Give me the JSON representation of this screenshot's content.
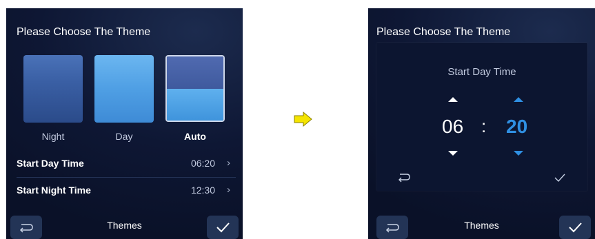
{
  "left_screen": {
    "title": "Please Choose The Theme",
    "themes": [
      {
        "label": "Night",
        "selected": false
      },
      {
        "label": "Day",
        "selected": false
      },
      {
        "label": "Auto",
        "selected": true
      }
    ],
    "rows": [
      {
        "label": "Start Day Time",
        "value": "06:20"
      },
      {
        "label": "Start Night Time",
        "value": "12:30"
      }
    ],
    "bottom_bar": {
      "title": "Themes"
    }
  },
  "right_screen": {
    "title": "Please Choose The Theme",
    "dialog": {
      "title": "Start Day Time",
      "hour": "06",
      "separator": ":",
      "minute": "20"
    },
    "bottom_bar": {
      "title": "Themes"
    }
  },
  "colors": {
    "accent_blue": "#2f8fe2",
    "arrow_yellow": "#f4e400"
  }
}
